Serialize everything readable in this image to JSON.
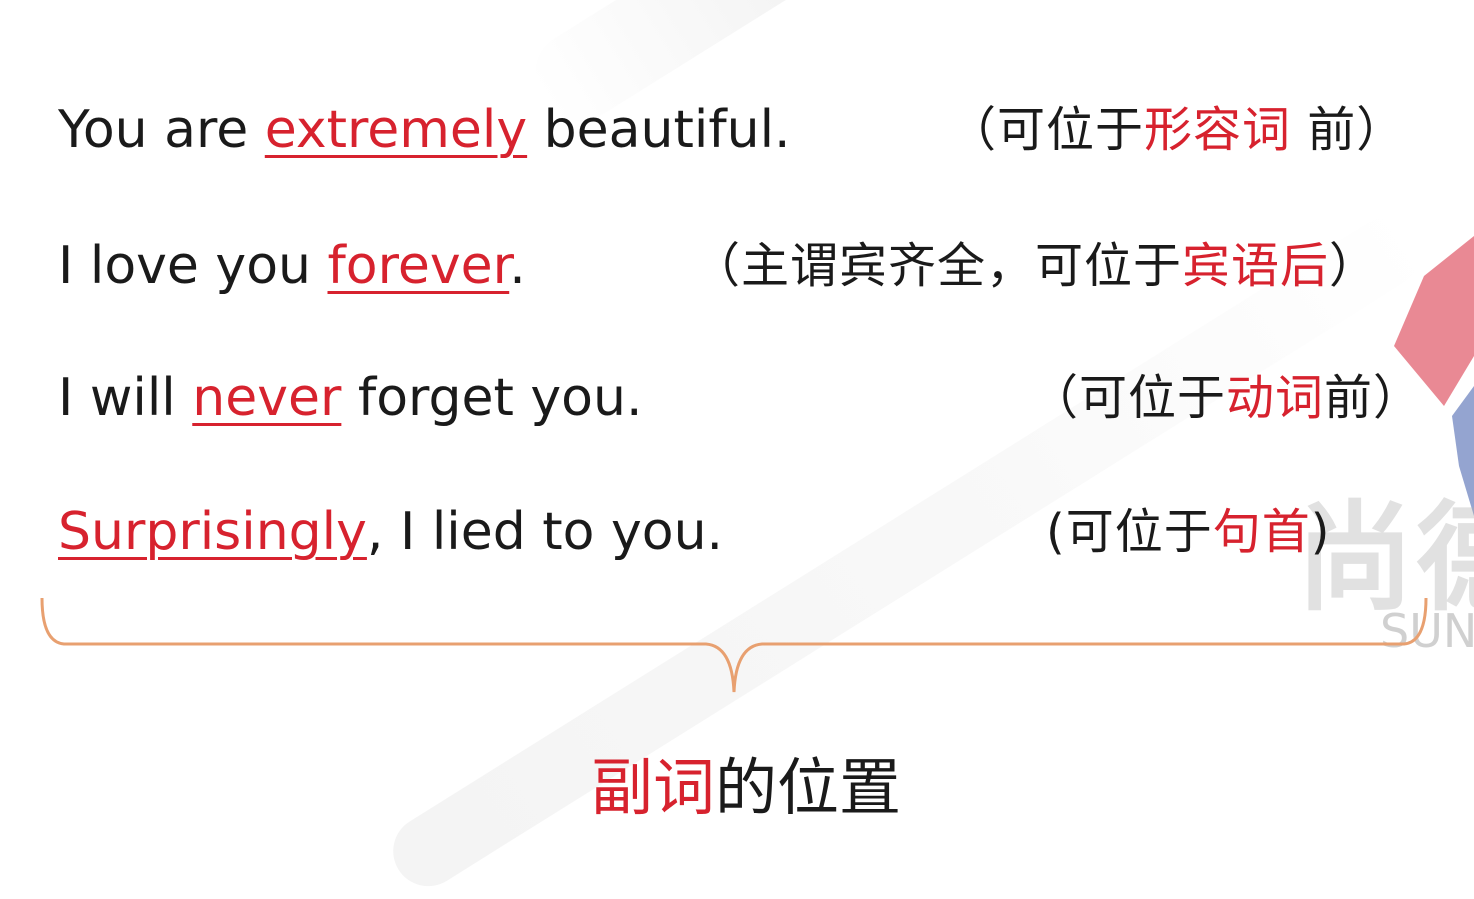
{
  "sentences": [
    {
      "before": "You are ",
      "adverb": "extremely",
      "after": " beautiful.",
      "note": {
        "open": "（可位于",
        "red": "形容词",
        "rest": " 前）"
      }
    },
    {
      "before": "I love you ",
      "adverb": "forever",
      "after": ".",
      "note": {
        "open": "（主谓宾齐全，可位于",
        "red": "宾语后",
        "rest": "）"
      }
    },
    {
      "before": "I will ",
      "adverb": "never",
      "after": " forget you.",
      "note": {
        "open": "（可位于",
        "red": "动词",
        "rest": "前）"
      }
    },
    {
      "before": "",
      "adverb": "Surprisingly",
      "after": ", I lied to you.",
      "note": {
        "open": "(可位于",
        "red": "句首",
        "rest": ")"
      }
    }
  ],
  "title": {
    "red": "副词",
    "rest": "的位置"
  },
  "watermark": {
    "logo_text": "尚德",
    "logo_sub": "SUN"
  },
  "colors": {
    "accent": "#d7222e",
    "brace": "#e8a070",
    "text": "#1a1a1a"
  }
}
